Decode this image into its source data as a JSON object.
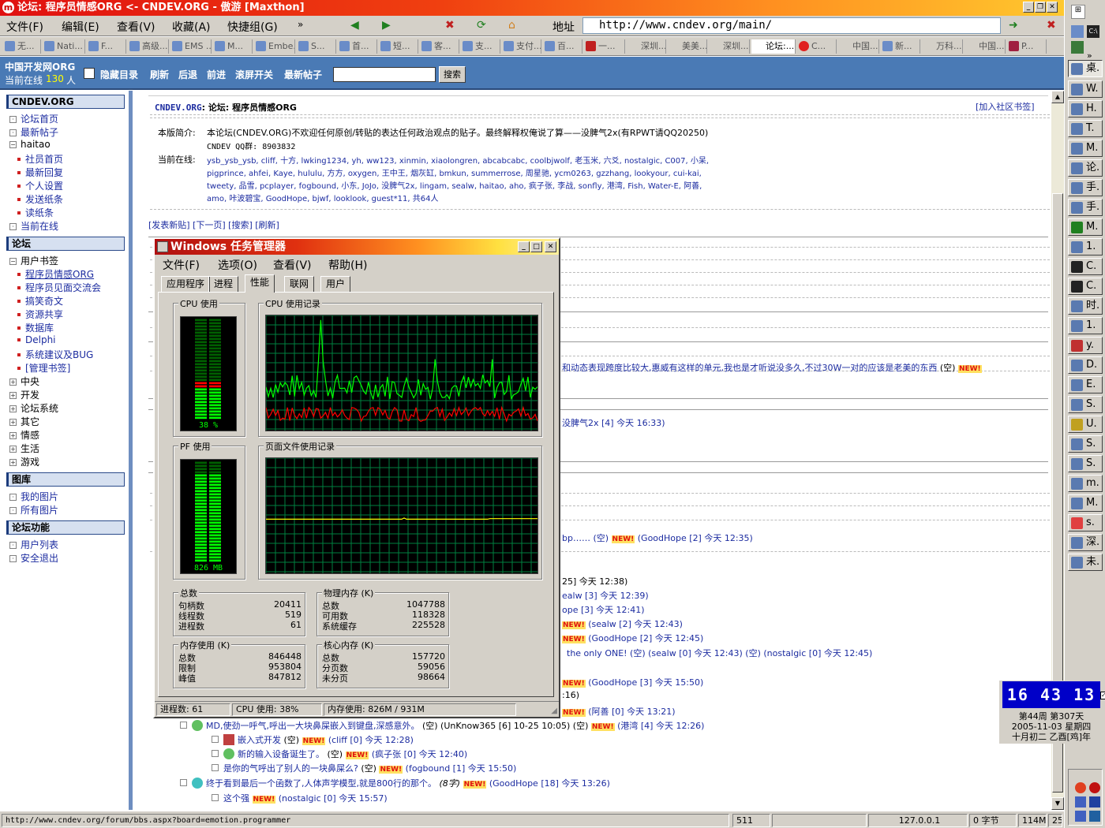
{
  "browser": {
    "title": "论坛: 程序员情感ORG <- CNDEV.ORG - 傲游 [Maxthon]",
    "menu": [
      "文件(F)",
      "编辑(E)",
      "查看(V)",
      "收藏(A)",
      "快捷组(G)"
    ],
    "address_label": "地址",
    "address": "http://www.cndev.org/main/",
    "tabs": [
      "无...",
      "Nati...",
      "F...",
      "高级...",
      "EMS ...",
      "M...",
      "Embe...",
      "S...",
      "首...",
      "短...",
      "客...",
      "支...",
      "支付...",
      "百...",
      "一...",
      "深圳...",
      "美美...",
      "深圳...",
      "论坛:...",
      "C...",
      "中国...",
      "新...",
      "万科...",
      "中国...",
      "P..."
    ]
  },
  "forum_bar": {
    "site_name": "中国开发网ORG",
    "online_label": "当前在线",
    "online_count": "130",
    "online_unit": "人",
    "buttons": [
      "隐藏目录",
      "刷新",
      "后退",
      "前进",
      "滚屏开关",
      "最新帖子"
    ],
    "search_button": "搜索"
  },
  "left_panel": {
    "section1": "CNDEV.ORG",
    "links1": [
      "论坛首页",
      "最新帖子"
    ],
    "user_node": "haitao",
    "user_links": [
      "社员首页",
      "最新回复",
      "个人设置",
      "发送纸条",
      "读纸条"
    ],
    "online_link": "当前在线",
    "section2": "论坛",
    "bookmarks_node": "用户书签",
    "bookmark_links": [
      "程序员情感ORG",
      "程序员见面交流会",
      "搞笑奇文",
      "资源共享",
      "数据库",
      "Delphi",
      "系统建议及BUG",
      "[管理书签]"
    ],
    "groups": [
      "中央",
      "开发",
      "论坛系统",
      "其它",
      "情感",
      "生活",
      "游戏"
    ],
    "section3": "图库",
    "gallery_links": [
      "我的图片",
      "所有图片"
    ],
    "section4": "论坛功能",
    "func_links": [
      "用户列表",
      "安全退出"
    ]
  },
  "main": {
    "header_site": "CNDEV.ORG",
    "header_sep": ": 论坛:",
    "header_board": "程序员情感ORG",
    "add_bookmark": "[加入社区书签]",
    "intro_label": "本版简介:",
    "intro_text": "本论坛(CNDEV.ORG)不欢迎任何原创/转贴的表达任何政治观点的贴子。最终解释权俺说了算——没脾气2x(有RPWT请QQ20250)",
    "qq_group": "CNDEV QQ群: 8903832",
    "online_label": "当前在线:",
    "online_lines": [
      "ysb_ysb_ysb, cliff, 十方, lwking1234, yh, ww123, xinmin, xiaolongren, abcabcabc, coolbjwolf, 老玉米, 六爻, nostalgic, C007, 小呆,",
      "pigprince, ahfei, Kaye, hululu, 方方, oxygen, 王中王, 烟灰缸, bmkun, summerrose, 周星驰, ycm0263, gzzhang, lookyour, cui-kai,",
      "tweety, 品雪, pcplayer, fogbound, 小东, JoJo, 没脾气2x, lingam, sealw, haitao, aho, 疯子张, 李战, sonfly, 港湾, Fish, Water-E, 阿善,",
      "amo, 咔波碧宝, GoodHope, bjwf, looklook, guest*11, 共64人"
    ],
    "actions": "[发表新贴] [下一页] [搜索] [刷新]",
    "partial_rows": [
      "和动态表现跨度比较大,惠威有这样的单元,我也是才听说没多久,不过30W一对的应该是老美的东西",
      "没脾气2x [4] 今天 16:33)",
      "bp…… (空)",
      "(GoodHope [2] 今天 12:35)",
      "25] 今天 12:38)",
      "ealw [3] 今天 12:39)",
      "ope [3] 今天 12:41)",
      "(sealw [2] 今天 12:43)",
      "(GoodHope [2] 今天 12:45)",
      "the only ONE! (空) (sealw [0] 今天 12:43) (空) (nostalgic [0] 今天 12:45)",
      "(GoodHope [3] 今天 15:50)",
      ":16)",
      "(阿善 [0] 今天 13:21)"
    ],
    "threads": [
      {
        "title": "MD,使劲一呼气,呼出一大块鼻屎嵌入到键盘,深感意外。",
        "meta": "(空) (UnKnow365 [6] 10-25 10:05) (空)",
        "tail": "(港湾 [4] 今天 12:26)"
      },
      {
        "title": "嵌入式开发",
        "meta": "(空)",
        "tail": "(cliff [0] 今天 12:28)"
      },
      {
        "title": "新的输入设备诞生了。",
        "meta": "(空)",
        "tail": "(疯子张 [0] 今天 12:40)"
      },
      {
        "title": "是你的气呼出了别人的一块鼻屎么?",
        "meta": "(空)",
        "tail": "(fogbound [1] 今天 15:50)"
      },
      {
        "title": "终于看到最后一个函数了,人体声学模型,就是800行的那个。",
        "meta": "(8字)",
        "tail": "(GoodHope [18] 今天 13:26)"
      },
      {
        "title": "这个强",
        "meta": "",
        "tail": "(nostalgic [0] 今天 15:57)"
      }
    ],
    "new_badge": "NEW!"
  },
  "statusbar": {
    "url": "http://www.cndev.org/forum/bbs.aspx?board=emotion.programmer",
    "count": "511",
    "ip": "127.0.0.1",
    "bytes": "0 字节",
    "mem": "114M",
    "num": "25"
  },
  "taskmgr": {
    "title": "Windows 任务管理器",
    "menu": [
      "文件(F)",
      "选项(O)",
      "查看(V)",
      "帮助(H)"
    ],
    "tabs": [
      "应用程序",
      "进程",
      "性能",
      "联网",
      "用户"
    ],
    "cpu_usage_label": "CPU 使用",
    "cpu_history_label": "CPU 使用记录",
    "pf_usage_label": "PF 使用",
    "pf_history_label": "页面文件使用记录",
    "cpu_percent": 38,
    "cpu_readout": "38 %",
    "pf_readout": "826 MB",
    "pf_fraction": 0.89,
    "totals_label": "总数",
    "totals": [
      [
        "句柄数",
        "20411"
      ],
      [
        "线程数",
        "519"
      ],
      [
        "进程数",
        "61"
      ]
    ],
    "physical_label": "物理内存 (K)",
    "physical": [
      [
        "总数",
        "1047788"
      ],
      [
        "可用数",
        "118328"
      ],
      [
        "系统缓存",
        "225528"
      ]
    ],
    "commit_label": "内存使用 (K)",
    "commit": [
      [
        "总数",
        "846448"
      ],
      [
        "限制",
        "953804"
      ],
      [
        "峰值",
        "847812"
      ]
    ],
    "kernel_label": "核心内存 (K)",
    "kernel": [
      [
        "总数",
        "157720"
      ],
      [
        "分页数",
        "59056"
      ],
      [
        "未分页",
        "98664"
      ]
    ],
    "status_processes": "进程数: 61",
    "status_cpu": "CPU 使用: 38%",
    "status_mem": "内存使用: 826M / 931M"
  },
  "clock": {
    "time": "16 43 13",
    "week": "第44周 第307天",
    "date": "2005-11-03 星期四",
    "lunar": "十月初二 乙酉[鸡]年"
  },
  "taskbar": {
    "items": [
      "桌.",
      "W.",
      "H.",
      "T.",
      "M.",
      "论.",
      "手.",
      "手.",
      "M.",
      "1.",
      "C.",
      "C.",
      "时.",
      "1.",
      "y.",
      "D.",
      "E.",
      "S.",
      "U.",
      "S.",
      "S.",
      "m.",
      "M.",
      "s.",
      "深.",
      "未."
    ]
  },
  "colors": {
    "accent": "#4a7ab5",
    "link": "#1c2ca0",
    "graph_green": "#00ff00",
    "graph_red": "#ff0000",
    "graph_yellow": "#ffff00"
  }
}
